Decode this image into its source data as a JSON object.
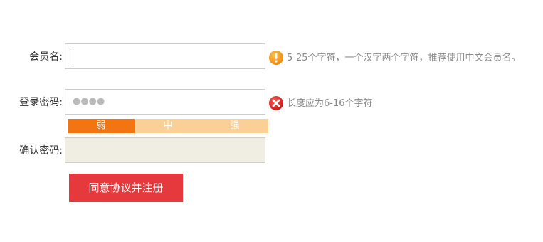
{
  "form": {
    "username": {
      "label": "会员名:",
      "value": "",
      "hint": "5-25个字符，一个汉字两个字符，推荐使用中文会员名。",
      "hint_icon": "warning-icon"
    },
    "password": {
      "label": "登录密码:",
      "value_masked": "●●●●",
      "hint": "长度应为6-16个字符",
      "hint_icon": "error-icon"
    },
    "strength": {
      "weak": "弱",
      "medium": "中",
      "strong": "强",
      "active_level": "weak"
    },
    "confirm": {
      "label": "确认密码:",
      "value": ""
    },
    "submit_label": "同意协议并注册"
  },
  "colors": {
    "warning": "#f5a020",
    "error": "#d9292b",
    "strength_active": "#f27512",
    "strength_inactive": "#fbd096",
    "submit": "#e5393e",
    "confirm_bg": "#f0eee3"
  }
}
